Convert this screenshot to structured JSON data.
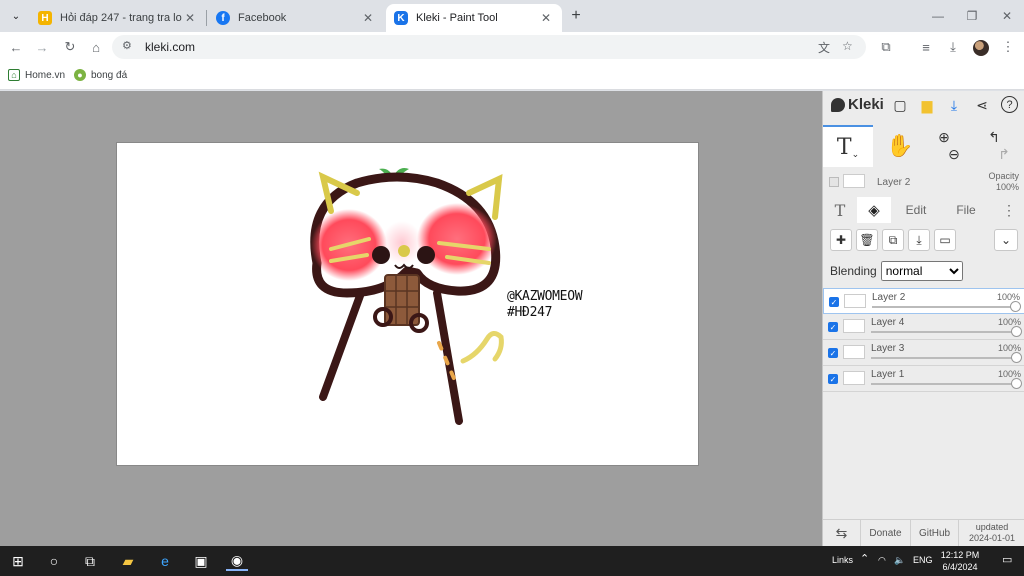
{
  "browser": {
    "tabs": [
      {
        "title": "Hỏi đáp 247 - trang tra loi",
        "favicon": "hoidap-icon",
        "active": false
      },
      {
        "title": "Facebook",
        "favicon": "facebook-icon",
        "active": false
      },
      {
        "title": "Kleki - Paint Tool",
        "favicon": "kleki-icon",
        "active": true
      }
    ],
    "url": "kleki.com",
    "bookmarks": [
      {
        "label": "Home.vn"
      },
      {
        "label": "bong đá"
      }
    ]
  },
  "kleki": {
    "logo": "Kleki",
    "current_layer": {
      "name": "Layer 2",
      "opacity_label": "Opacity",
      "opacity_value": "100%"
    },
    "tabs": {
      "edit": "Edit",
      "file": "File"
    },
    "blending": {
      "label": "Blending",
      "value": "normal"
    },
    "layers": [
      {
        "name": "Layer 2",
        "opacity": "100%",
        "selected": true
      },
      {
        "name": "Layer 4",
        "opacity": "100%",
        "selected": false
      },
      {
        "name": "Layer 3",
        "opacity": "100%",
        "selected": false
      },
      {
        "name": "Layer 1",
        "opacity": "100%",
        "selected": false
      }
    ],
    "footer": {
      "donate": "Donate",
      "github": "GitHub",
      "updated_label": "updated",
      "updated_date": "2024-01-01"
    }
  },
  "artwork": {
    "caption_line1": "@KAZWOMEOW",
    "caption_line2": "#HĐ247"
  },
  "taskbar": {
    "links": "Links",
    "lang": "ENG",
    "time": "12:12 PM",
    "date": "6/4/2024"
  },
  "colors": {
    "accent": "#1a73e8",
    "hoidap": "#f4b400",
    "facebook": "#1877f2"
  }
}
